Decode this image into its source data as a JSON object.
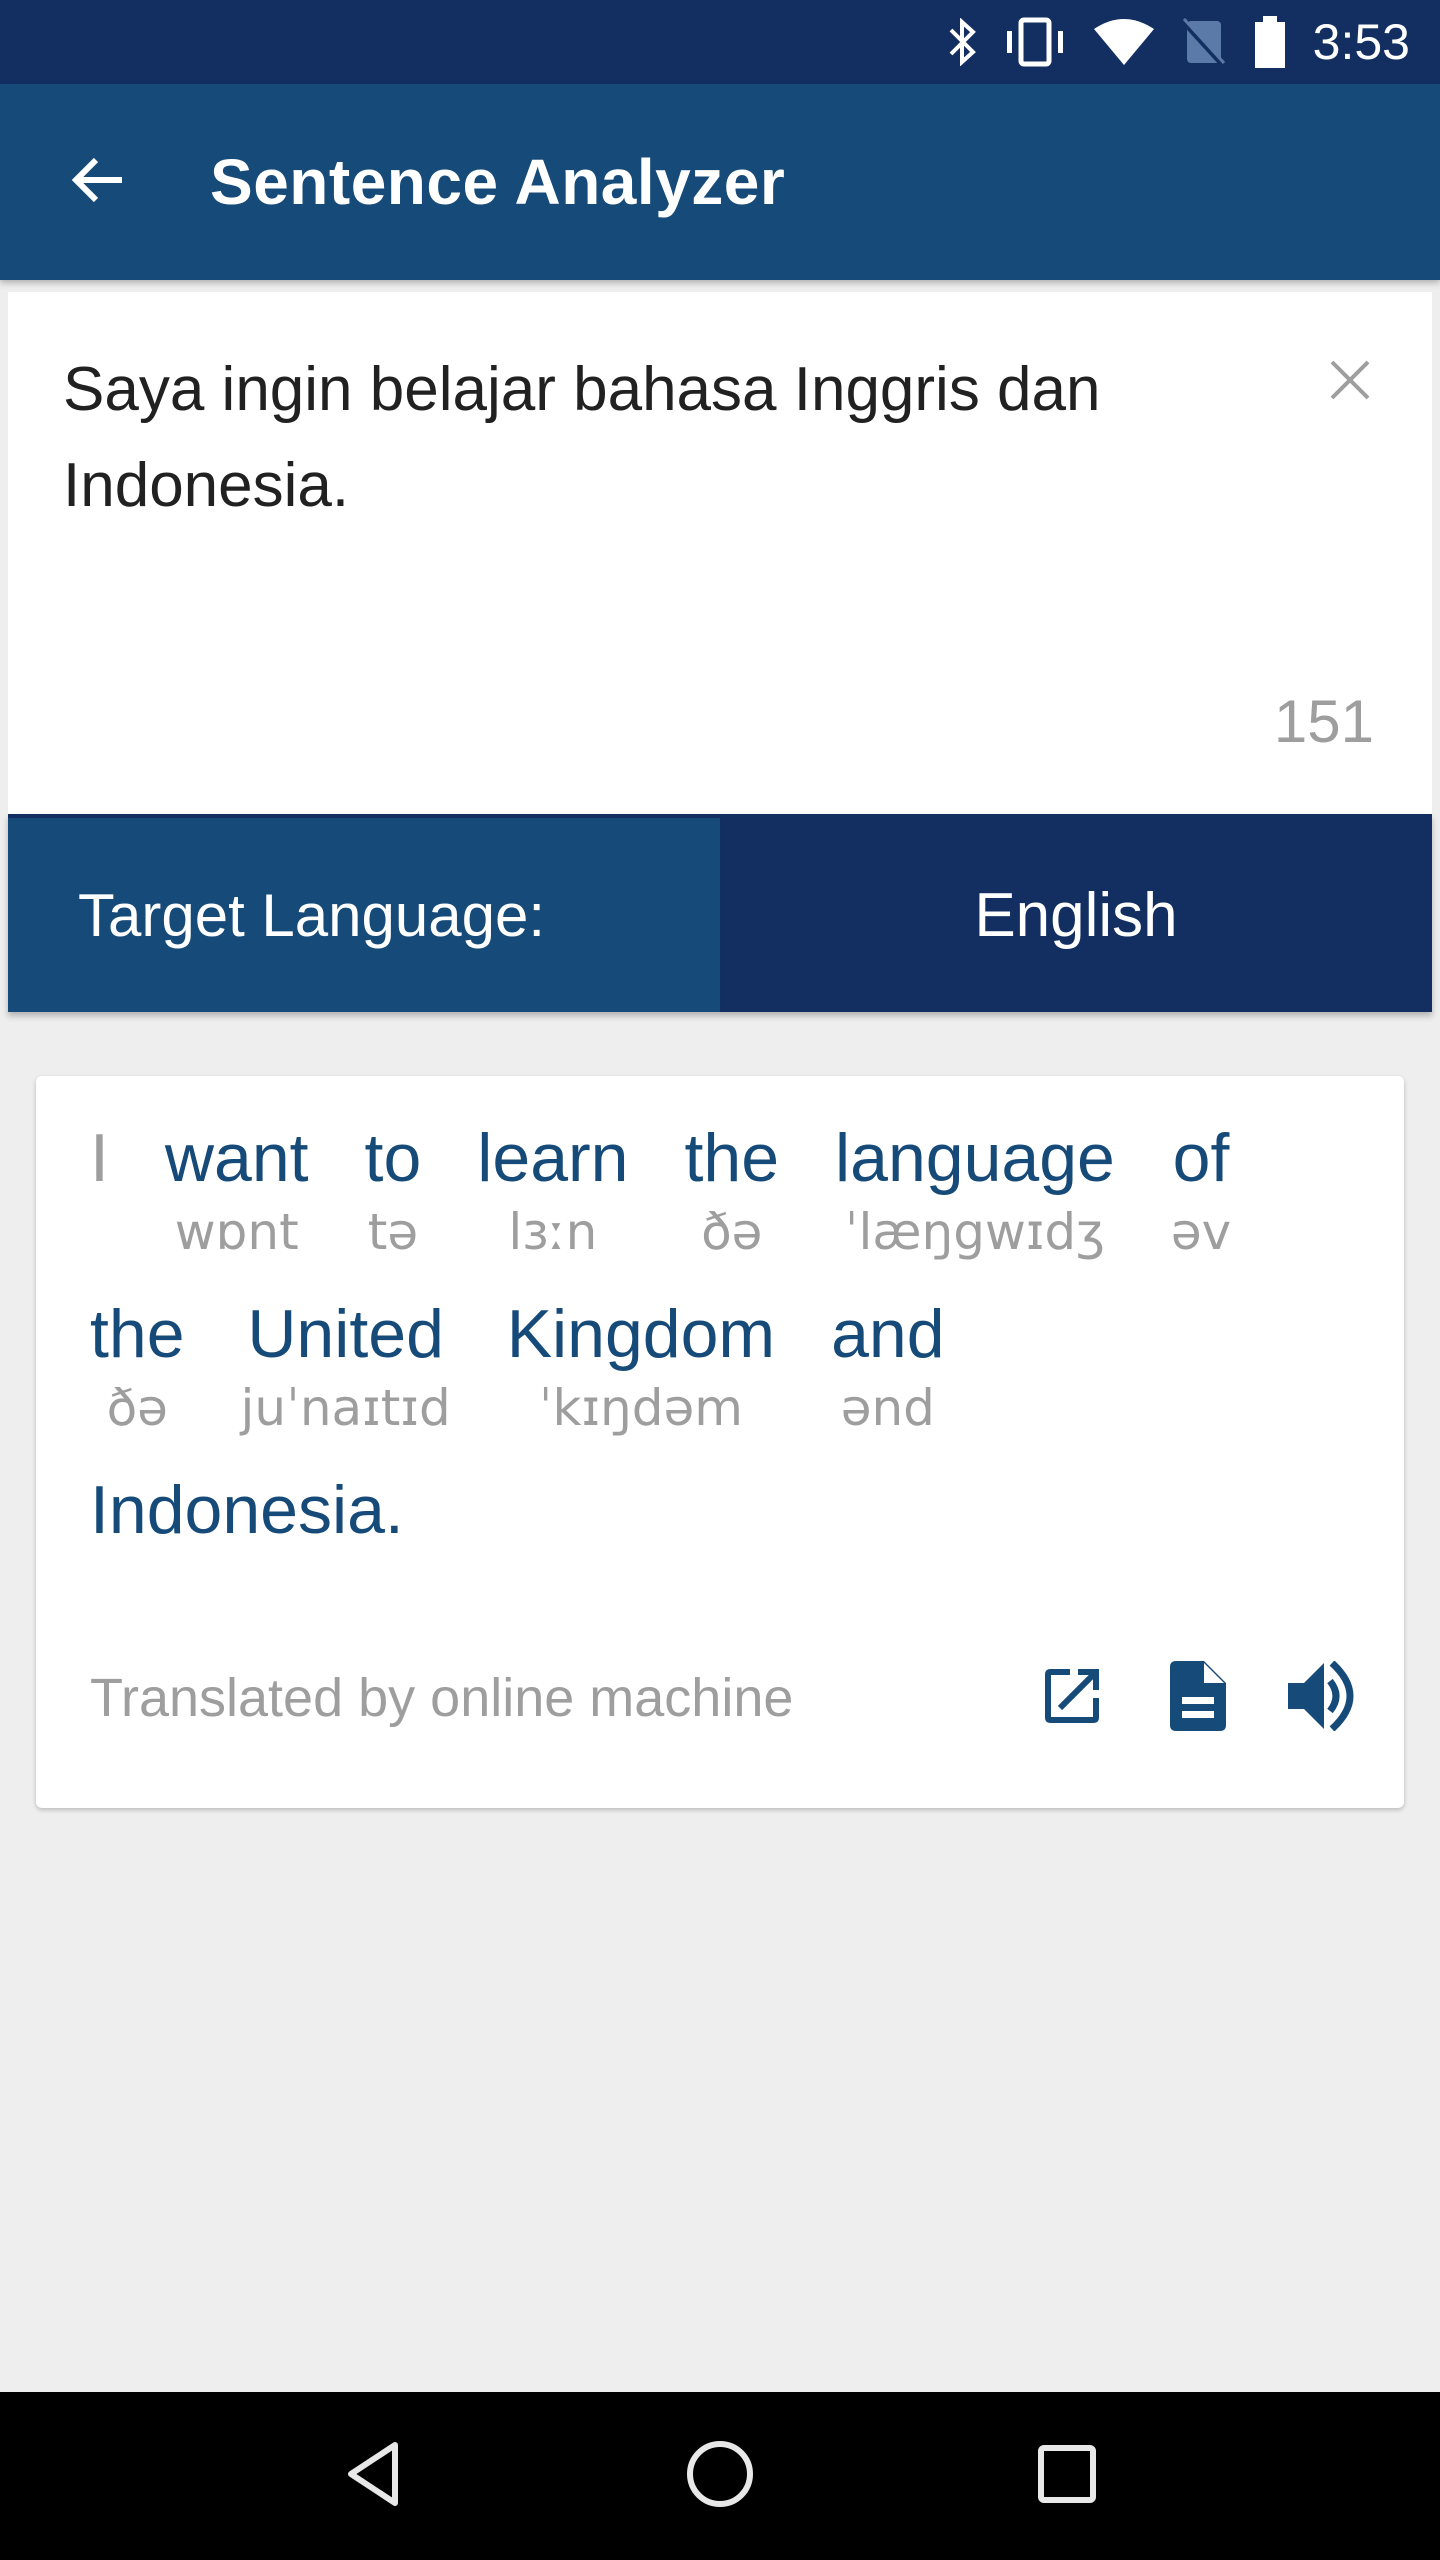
{
  "status_bar": {
    "time": "3:53",
    "icons": [
      "bluetooth-icon",
      "vibrate-icon",
      "wifi-icon",
      "no-sim-icon",
      "battery-icon"
    ]
  },
  "app_bar": {
    "title": "Sentence Analyzer",
    "back_icon": "arrow-back-icon"
  },
  "input": {
    "text": "Saya ingin belajar bahasa Inggris dan Indonesia.",
    "char_count": "151",
    "clear_icon": "close-icon"
  },
  "target_language": {
    "label": "Target Language:",
    "value": "English"
  },
  "result": {
    "words": [
      {
        "word": "I",
        "ipa": ""
      },
      {
        "word": "want",
        "ipa": "wɒnt"
      },
      {
        "word": "to",
        "ipa": "tə"
      },
      {
        "word": "learn",
        "ipa": "lɜːn"
      },
      {
        "word": "the",
        "ipa": "ðə"
      },
      {
        "word": "language",
        "ipa": "ˈlæŋgwɪdʒ"
      },
      {
        "word": "of",
        "ipa": "əv"
      },
      {
        "word": "the",
        "ipa": "ðə"
      },
      {
        "word": "United",
        "ipa": "juˈnaɪtɪd"
      },
      {
        "word": "Kingdom",
        "ipa": "ˈkɪŋdəm"
      },
      {
        "word": "and",
        "ipa": "ənd"
      },
      {
        "word": "Indonesia.",
        "ipa": ""
      }
    ],
    "credit": "Translated by online machine",
    "actions": [
      "open-external-icon",
      "document-icon",
      "speaker-icon"
    ]
  },
  "nav_bar": {
    "buttons": [
      "back-triangle-icon",
      "home-circle-icon",
      "recents-square-icon"
    ]
  },
  "colors": {
    "status_bar": "#132f62",
    "primary": "#164a78",
    "primary_dark": "#132f62",
    "muted_text": "#9e9e9e",
    "background": "#eeeeee"
  }
}
